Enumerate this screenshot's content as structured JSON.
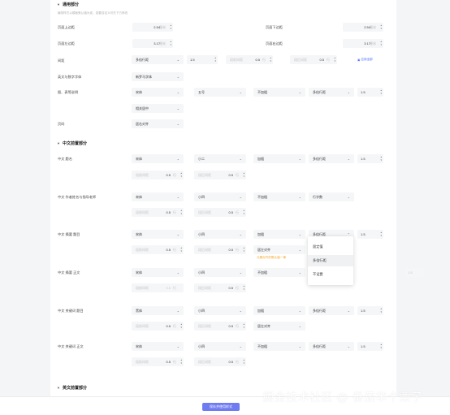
{
  "general": {
    "title": "通用部分",
    "hint": "编排样式以模板默认值为准，若要自定义可在下方修改",
    "margin_top_label": "页面上边距",
    "margin_top_value": "2.54",
    "margin_top_unit": "厘米",
    "margin_bottom_label": "页面下边距",
    "margin_bottom_value": "2.54",
    "margin_bottom_unit": "厘米",
    "margin_left_label": "页面左边距",
    "margin_left_value": "3.17",
    "margin_left_unit": "厘米",
    "margin_right_label": "页面右边距",
    "margin_right_value": "3.17",
    "margin_right_unit": "厘米",
    "spacing_label": "间距",
    "spacing_mode": "多倍行距",
    "spacing_value": "1.5",
    "spacing_before_label": "段前间距",
    "spacing_before_value": "0.5",
    "spacing_before_unit": "行",
    "spacing_after_label": "段后间距",
    "spacing_after_value": "0.5",
    "spacing_after_unit": "行",
    "apply_link": "应用全部",
    "digits_label": "英文与数字字体",
    "digits_value": "新罗马字体",
    "table_label": "图、表等说明",
    "table_font": "宋体",
    "table_size": "五号",
    "table_bold": "不加粗",
    "table_spacing": "多倍行距",
    "table_spacing_value": "1.5",
    "table_align": "相关居中",
    "page_no_label": "页码",
    "page_no_value": "居右对齐"
  },
  "cn": {
    "title": "中文前置部分",
    "title_row": {
      "label": "中文 题名",
      "font": "宋体",
      "size": "小二",
      "bold": "加粗",
      "spacing": "多倍行距",
      "spacing_value": "1.5",
      "before_label": "段前间距",
      "before_value": "0.5",
      "before_unit": "行",
      "after_label": "段后间距",
      "after_value": "0.5",
      "after_unit": "行"
    },
    "author_row": {
      "label": "中文 作者姓名与指导老师",
      "font": "宋体",
      "size": "小四",
      "bold": "不加粗",
      "spacing": "行字数",
      "before_label": "段前间距",
      "before_value": "0.5",
      "before_unit": "行",
      "after_label": "段后间距",
      "after_value": "0.5",
      "after_unit": "行"
    },
    "abstract_title_row": {
      "label": "中文 摘要 题目",
      "font": "宋体",
      "size": "小四",
      "bold": "加粗",
      "spacing": "多倍行距",
      "spacing_value": "1.5",
      "before_label": "段前间距",
      "before_value": "0.5",
      "before_unit": "行",
      "after_label": "段后间距",
      "after_value": "0.5",
      "after_unit": "行",
      "align": "居左对齐",
      "error": "元素对齐的默认值一律"
    },
    "abstract_body_row": {
      "label": "中文 摘要 正文",
      "font": "宋体",
      "size": "小四",
      "bold": "不加粗",
      "spacing_value": "1.5",
      "before_label": "段前间距",
      "before_value": "0.5",
      "before_unit": "行",
      "after_label": "段后间距",
      "after_value": "0.5",
      "after_unit": "行"
    },
    "keyword_title_row": {
      "label": "中文 关键词 题目",
      "font": "黑体",
      "size": "小四",
      "bold": "加粗",
      "spacing": "多倍行距",
      "spacing_value": "1.5",
      "before_label": "段前间距",
      "before_value": "0.5",
      "before_unit": "行",
      "after_label": "段后间距",
      "after_value": "0.5",
      "after_unit": "行",
      "align": "居左对齐"
    },
    "keyword_body_row": {
      "label": "中文 关键词 正文",
      "font": "宋体",
      "size": "小四",
      "bold": "不加粗",
      "spacing": "多倍行距",
      "spacing_value": "1.5",
      "before_label": "段前间距",
      "before_value": "0.5",
      "before_unit": "行",
      "after_label": "段后间距",
      "after_value": "0.5",
      "after_unit": "行"
    }
  },
  "dropdown": {
    "items": [
      "固定值",
      "多倍行距",
      "不设置"
    ],
    "selected": "多倍行距"
  },
  "en": {
    "title": "英文前置部分"
  },
  "footer": {
    "save_label": "保存并使用样式"
  },
  "watermark": "掘金技术社区 @ 番茄举个栗子",
  "colors": {
    "accent": "#6f7bf0",
    "link": "#4a6cf7",
    "warning": "#f5a623"
  }
}
